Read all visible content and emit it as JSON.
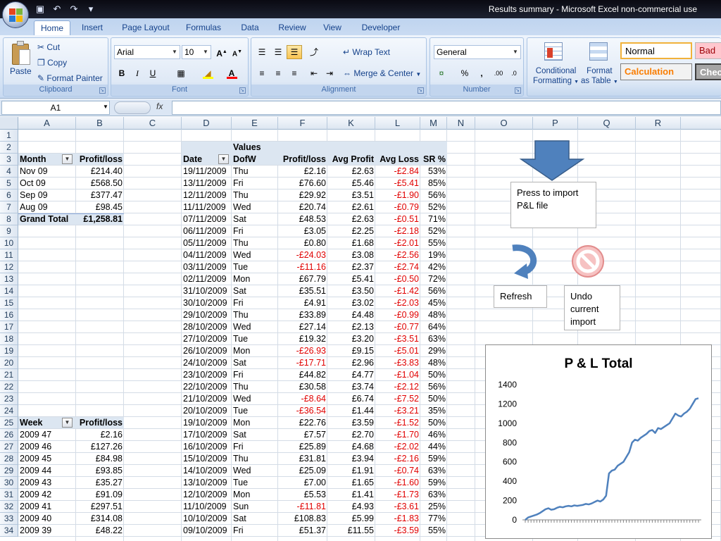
{
  "window": {
    "title": "Results summary - Microsoft Excel non-commercial use"
  },
  "ribbon": {
    "tabs": [
      "Home",
      "Insert",
      "Page Layout",
      "Formulas",
      "Data",
      "Review",
      "View",
      "Developer"
    ],
    "active_tab": "Home",
    "clipboard": {
      "paste": "Paste",
      "cut": "Cut",
      "copy": "Copy",
      "format_painter": "Format Painter",
      "label": "Clipboard"
    },
    "font": {
      "name": "Arial",
      "size": "10",
      "label": "Font",
      "bold": "B",
      "italic": "I",
      "underline": "U"
    },
    "alignment": {
      "wrap_text": "Wrap Text",
      "merge_center": "Merge & Center",
      "label": "Alignment"
    },
    "number": {
      "format": "General",
      "percent": "%",
      "comma": ",",
      "label": "Number"
    },
    "styles": {
      "conditional": "Conditional",
      "conditional2": "Formatting",
      "format_table": "Format",
      "format_table2": "as Table",
      "normal": "Normal",
      "bad": "Bad",
      "calculation": "Calculation",
      "check": "Check"
    }
  },
  "formula_bar": {
    "name_box": "A1",
    "fx": "fx",
    "formula": ""
  },
  "columns": [
    "A",
    "B",
    "C",
    "D",
    "E",
    "F",
    "K",
    "L",
    "M",
    "N",
    "O",
    "P",
    "Q",
    "R"
  ],
  "rows": [
    "1",
    "2",
    "3",
    "4",
    "5",
    "6",
    "7",
    "8",
    "9",
    "10",
    "11",
    "12",
    "13",
    "14",
    "15",
    "16",
    "17",
    "18",
    "19",
    "20",
    "21",
    "22",
    "23",
    "24",
    "25",
    "26",
    "27",
    "28",
    "29",
    "30",
    "31",
    "32",
    "33",
    "34"
  ],
  "month_pivot": {
    "headers": [
      "Month",
      "Profit/loss"
    ],
    "rows": [
      [
        "Nov 09",
        "£214.40"
      ],
      [
        "Oct 09",
        "£568.50"
      ],
      [
        "Sep 09",
        "£377.47"
      ],
      [
        "Aug 09",
        "£98.45"
      ]
    ],
    "total": [
      "Grand Total",
      "£1,258.81"
    ]
  },
  "day_pivot": {
    "values_label": "Values",
    "headers": [
      "Date",
      "DofW",
      "Profit/loss",
      "Avg Profit",
      "Avg Loss",
      "SR %"
    ],
    "rows": [
      [
        "19/11/2009",
        "Thu",
        "£2.16",
        "£2.63",
        "-£2.84",
        "53%"
      ],
      [
        "13/11/2009",
        "Fri",
        "£76.60",
        "£5.46",
        "-£5.41",
        "85%"
      ],
      [
        "12/11/2009",
        "Thu",
        "£29.92",
        "£3.51",
        "-£1.90",
        "56%"
      ],
      [
        "11/11/2009",
        "Wed",
        "£20.74",
        "£2.61",
        "-£0.79",
        "52%"
      ],
      [
        "07/11/2009",
        "Sat",
        "£48.53",
        "£2.63",
        "-£0.51",
        "71%"
      ],
      [
        "06/11/2009",
        "Fri",
        "£3.05",
        "£2.25",
        "-£2.18",
        "52%"
      ],
      [
        "05/11/2009",
        "Thu",
        "£0.80",
        "£1.68",
        "-£2.01",
        "55%"
      ],
      [
        "04/11/2009",
        "Wed",
        "-£24.03",
        "£3.08",
        "-£2.56",
        "19%"
      ],
      [
        "03/11/2009",
        "Tue",
        "-£11.16",
        "£2.37",
        "-£2.74",
        "42%"
      ],
      [
        "02/11/2009",
        "Mon",
        "£67.79",
        "£5.41",
        "-£0.50",
        "72%"
      ],
      [
        "31/10/2009",
        "Sat",
        "£35.51",
        "£3.50",
        "-£1.42",
        "56%"
      ],
      [
        "30/10/2009",
        "Fri",
        "£4.91",
        "£3.02",
        "-£2.03",
        "45%"
      ],
      [
        "29/10/2009",
        "Thu",
        "£33.89",
        "£4.48",
        "-£0.99",
        "48%"
      ],
      [
        "28/10/2009",
        "Wed",
        "£27.14",
        "£2.13",
        "-£0.77",
        "64%"
      ],
      [
        "27/10/2009",
        "Tue",
        "£19.32",
        "£3.20",
        "-£3.51",
        "63%"
      ],
      [
        "26/10/2009",
        "Mon",
        "-£26.93",
        "£9.15",
        "-£5.01",
        "29%"
      ],
      [
        "24/10/2009",
        "Sat",
        "-£17.71",
        "£2.96",
        "-£3.83",
        "48%"
      ],
      [
        "23/10/2009",
        "Fri",
        "£44.82",
        "£4.77",
        "-£1.04",
        "50%"
      ],
      [
        "22/10/2009",
        "Thu",
        "£30.58",
        "£3.74",
        "-£2.12",
        "56%"
      ],
      [
        "21/10/2009",
        "Wed",
        "-£8.64",
        "£6.74",
        "-£7.52",
        "50%"
      ],
      [
        "20/10/2009",
        "Tue",
        "-£36.54",
        "£1.44",
        "-£3.21",
        "35%"
      ],
      [
        "19/10/2009",
        "Mon",
        "£22.76",
        "£3.59",
        "-£1.52",
        "50%"
      ],
      [
        "17/10/2009",
        "Sat",
        "£7.57",
        "£2.70",
        "-£1.70",
        "46%"
      ],
      [
        "16/10/2009",
        "Fri",
        "£25.89",
        "£4.68",
        "-£2.02",
        "44%"
      ],
      [
        "15/10/2009",
        "Thu",
        "£31.81",
        "£3.94",
        "-£2.16",
        "59%"
      ],
      [
        "14/10/2009",
        "Wed",
        "£25.09",
        "£1.91",
        "-£0.74",
        "63%"
      ],
      [
        "13/10/2009",
        "Tue",
        "£7.00",
        "£1.65",
        "-£1.60",
        "59%"
      ],
      [
        "12/10/2009",
        "Mon",
        "£5.53",
        "£1.41",
        "-£1.73",
        "63%"
      ],
      [
        "11/10/2009",
        "Sun",
        "-£11.81",
        "£4.93",
        "-£3.61",
        "25%"
      ],
      [
        "10/10/2009",
        "Sat",
        "£108.83",
        "£5.99",
        "-£1.83",
        "77%"
      ],
      [
        "09/10/2009",
        "Fri",
        "£51.37",
        "£11.55",
        "-£3.59",
        "55%"
      ]
    ]
  },
  "week_pivot": {
    "headers": [
      "Week",
      "Profit/loss"
    ],
    "rows": [
      [
        "2009 47",
        "£2.16"
      ],
      [
        "2009 46",
        "£127.26"
      ],
      [
        "2009 45",
        "£84.98"
      ],
      [
        "2009 44",
        "£93.85"
      ],
      [
        "2009 43",
        "£35.27"
      ],
      [
        "2009 42",
        "£91.09"
      ],
      [
        "2009 41",
        "£297.51"
      ],
      [
        "2009 40",
        "£314.08"
      ],
      [
        "2009 39",
        "£48.22"
      ]
    ]
  },
  "shapes": {
    "import": "Press to import P&L file",
    "refresh": "Refresh",
    "undo": "Undo current import"
  },
  "chart_data": {
    "type": "line",
    "title": "P & L Total",
    "xlabel": "",
    "ylabel": "",
    "ylim": [
      0,
      1400
    ],
    "yticks": [
      0,
      200,
      400,
      600,
      800,
      1000,
      1200,
      1400
    ],
    "series": [
      {
        "values": [
          0,
          25,
          35,
          45,
          55,
          70,
          90,
          110,
          120,
          105,
          110,
          125,
          135,
          130,
          140,
          145,
          140,
          150,
          145,
          150,
          155,
          165,
          160,
          170,
          185,
          200,
          190,
          210,
          250,
          480,
          510,
          520,
          560,
          580,
          600,
          650,
          700,
          800,
          830,
          820,
          850,
          870,
          890,
          920,
          930,
          900,
          950,
          940,
          960,
          980,
          1000,
          1050,
          1100,
          1080,
          1070,
          1100,
          1120,
          1150,
          1200,
          1250,
          1259
        ]
      }
    ],
    "line_color": "#4f81bd"
  }
}
